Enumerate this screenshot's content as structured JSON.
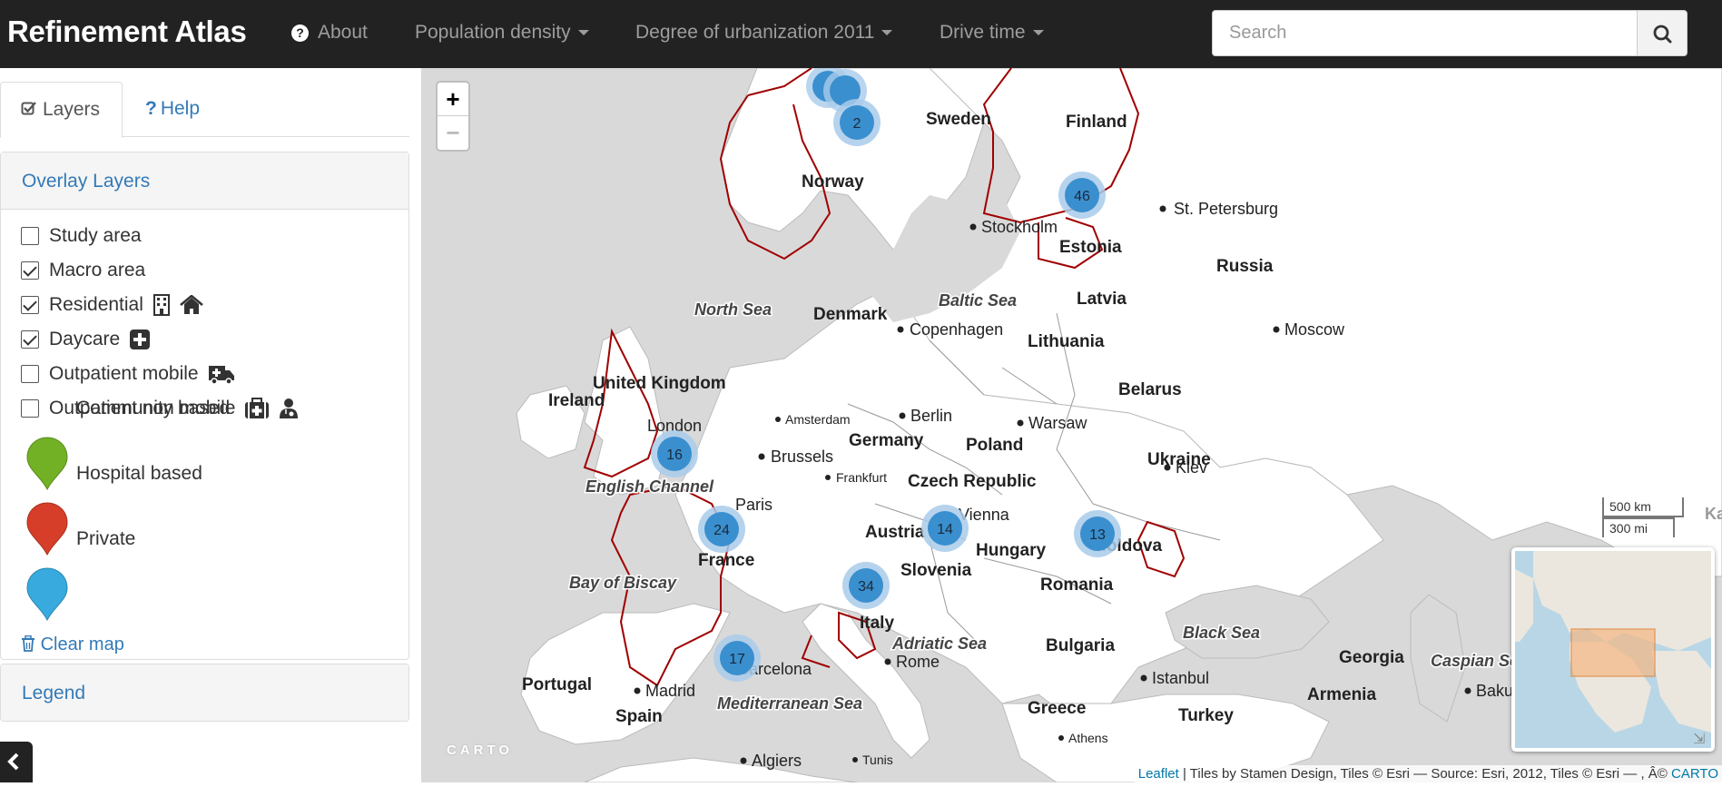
{
  "navbar": {
    "brand": "Refinement Atlas",
    "about": "About",
    "menus": [
      "Population density",
      "Degree of urbanization 2011",
      "Drive time"
    ],
    "search_placeholder": "Search"
  },
  "sidebar": {
    "tabs": {
      "layers": "Layers",
      "help": "Help"
    },
    "overlay_title": "Overlay Layers",
    "layers": [
      {
        "label": "Study area",
        "checked": false
      },
      {
        "label": "Macro area",
        "checked": true
      },
      {
        "label": "Residential",
        "checked": true
      },
      {
        "label": "Daycare",
        "checked": true
      },
      {
        "label": "Outpatient mobile",
        "checked": false
      },
      {
        "label": "Outpatient non mobile",
        "checked": false
      }
    ],
    "markers": [
      {
        "label": "Community based",
        "color": "#72b026"
      },
      {
        "label": "Hospital based",
        "color": "#d63e2a"
      },
      {
        "label": "Private",
        "color": "#38aadd"
      }
    ],
    "clear_map": "Clear map",
    "legend_title": "Legend"
  },
  "map": {
    "countries": [
      "Sweden",
      "Finland",
      "Norway",
      "Estonia",
      "Russia",
      "Latvia",
      "Denmark",
      "Lithuania",
      "United Kingdom",
      "Ireland",
      "Belarus",
      "Germany",
      "Poland",
      "Czech Republic",
      "Ukraine",
      "Austria",
      "Hungary",
      "France",
      "Slovenia",
      "Moldova",
      "Romania",
      "Italy",
      "Bulgaria",
      "Portugal",
      "Spain",
      "Greece",
      "Turkey",
      "Georgia",
      "Armenia"
    ],
    "cities": [
      "St. Petersburg",
      "Stockholm",
      "Copenhagen",
      "Moscow",
      "London",
      "Amsterdam",
      "Berlin",
      "Warsaw",
      "Brussels",
      "Frankfurt",
      "Kiev",
      "Paris",
      "Vienna",
      "Rome",
      "Madrid",
      "Barcelona",
      "Istanbul",
      "Baku",
      "Athens",
      "Algiers",
      "Tunis"
    ],
    "seas": [
      "North Sea",
      "Baltic Sea",
      "English Channel",
      "Bay of Biscay",
      "Adriatic Sea",
      "Black Sea",
      "Mediterranean Sea",
      "Caspian Sea"
    ],
    "clusters": [
      {
        "count": "2"
      },
      {
        "count": "46"
      },
      {
        "count": "16"
      },
      {
        "count": "24"
      },
      {
        "count": "14"
      },
      {
        "count": "13"
      },
      {
        "count": "34"
      },
      {
        "count": "17"
      }
    ],
    "scale": {
      "km": "500 km",
      "mi": "300 mi"
    },
    "zoom_in": "+",
    "zoom_out": "−",
    "carto": "CARTO",
    "attribution": {
      "leaflet": "Leaflet",
      "text": " | Tiles by Stamen Design, Tiles © Esri — Source: Esri, 2012, Tiles © Esri — , Â© ",
      "carto_link": "CARTO"
    },
    "colors": {
      "boundary": "#a00000",
      "land": "#ffffff",
      "outside": "#d9d9d9",
      "cluster": "#3a8fcf"
    }
  }
}
